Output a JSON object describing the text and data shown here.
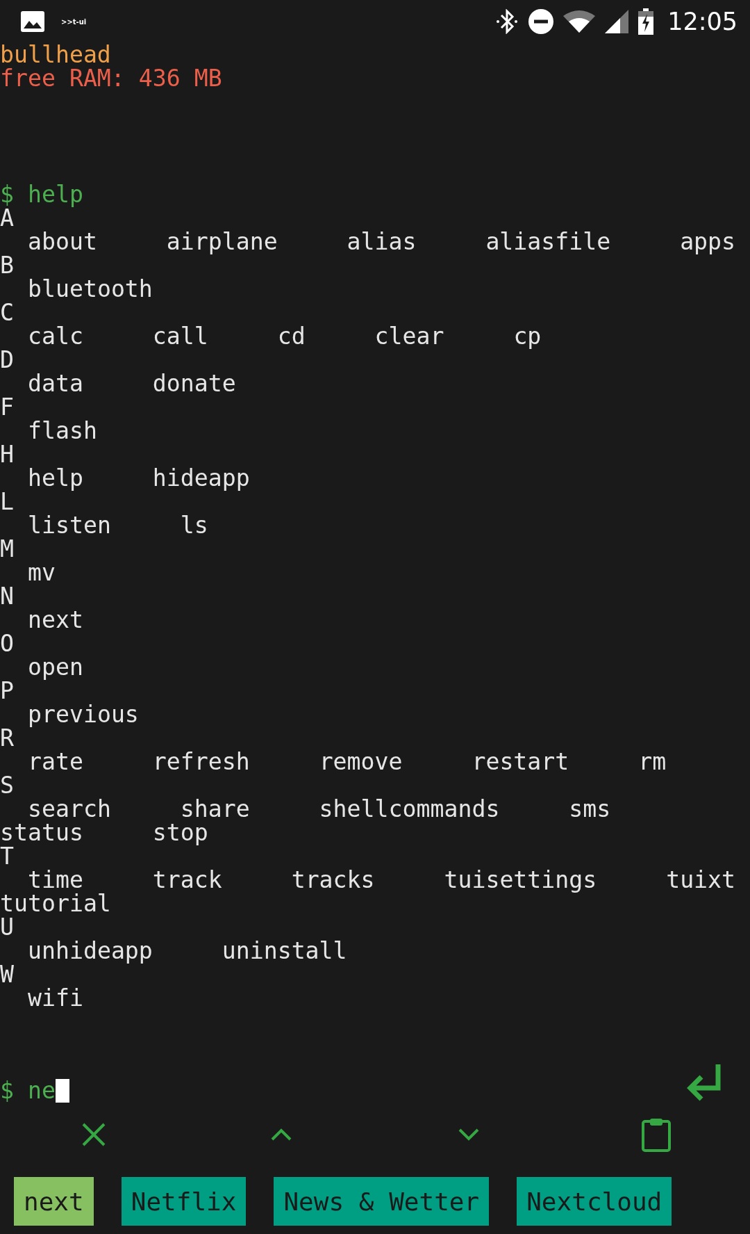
{
  "status_bar": {
    "app_label": ">>t-ui",
    "time": "12:05"
  },
  "device": {
    "name": "bullhead",
    "free_ram": "free RAM: 436 MB"
  },
  "output": {
    "prompt": "$",
    "command": "help",
    "groups": [
      {
        "letter": "A",
        "commands": [
          "about",
          "airplane",
          "alias",
          "aliasfile",
          "apps"
        ]
      },
      {
        "letter": "B",
        "commands": [
          "bluetooth"
        ]
      },
      {
        "letter": "C",
        "commands": [
          "calc",
          "call",
          "cd",
          "clear",
          "cp"
        ]
      },
      {
        "letter": "D",
        "commands": [
          "data",
          "donate"
        ]
      },
      {
        "letter": "F",
        "commands": [
          "flash"
        ]
      },
      {
        "letter": "H",
        "commands": [
          "help",
          "hideapp"
        ]
      },
      {
        "letter": "L",
        "commands": [
          "listen",
          "ls"
        ]
      },
      {
        "letter": "M",
        "commands": [
          "mv"
        ]
      },
      {
        "letter": "N",
        "commands": [
          "next"
        ]
      },
      {
        "letter": "O",
        "commands": [
          "open"
        ]
      },
      {
        "letter": "P",
        "commands": [
          "previous"
        ]
      },
      {
        "letter": "R",
        "commands": [
          "rate",
          "refresh",
          "remove",
          "restart",
          "rm"
        ]
      },
      {
        "letter": "S",
        "commands": [
          "search",
          "share",
          "shellcommands",
          "sms",
          "status",
          "stop"
        ]
      },
      {
        "letter": "T",
        "commands": [
          "time",
          "track",
          "tracks",
          "tuisettings",
          "tuixt",
          "tutorial"
        ]
      },
      {
        "letter": "U",
        "commands": [
          "unhideapp",
          "uninstall"
        ]
      },
      {
        "letter": "W",
        "commands": [
          "wifi"
        ]
      }
    ]
  },
  "input": {
    "prompt": "$",
    "value": "ne"
  },
  "suggestions": [
    {
      "label": "next",
      "kind": "command"
    },
    {
      "label": "Netflix",
      "kind": "app"
    },
    {
      "label": "News & Wetter",
      "kind": "app"
    },
    {
      "label": "Nextcloud",
      "kind": "app"
    }
  ]
}
